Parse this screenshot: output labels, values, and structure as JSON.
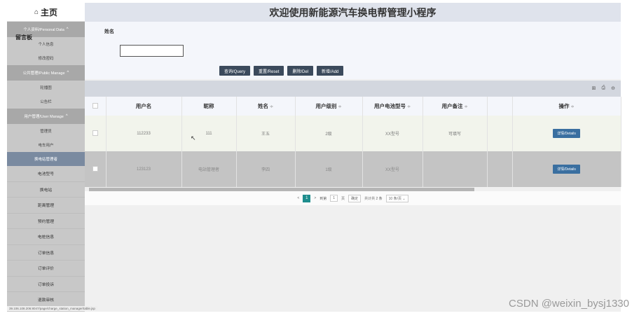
{
  "sidebar": {
    "home_label": "主页",
    "overlay_label": "留言板",
    "groups": [
      {
        "label": "个人资料/Personal Data",
        "items": [
          "个人信息",
          "修改密码"
        ]
      },
      {
        "label": "公共管理/Public Manage",
        "items": [
          "轮播图",
          "公告栏"
        ]
      },
      {
        "label": "用户管理/User Manage",
        "items": [
          "管理员",
          "电车用户",
          "换电站管理者"
        ]
      }
    ],
    "main_items": [
      "电池型号",
      "换电站",
      "距离管理",
      "预约管理",
      "电桩信息",
      "订单信息",
      "订单评价",
      "订单投诉",
      "退款审核"
    ]
  },
  "header": {
    "title": "欢迎使用新能源汽车换电帮管理小程序"
  },
  "search": {
    "name_label": "姓名",
    "name_value": "",
    "buttons": {
      "query": "查询/Query",
      "reset": "重置/Reset",
      "delete": "删除/Del",
      "add": "新增/Add"
    }
  },
  "table": {
    "headers": [
      "用户名",
      "昵称",
      "姓名",
      "用户级别",
      "用户电池型号",
      "用户备注",
      "",
      "操作"
    ],
    "sort_glyph": "≑",
    "rows": [
      {
        "username": "112233",
        "nickname": "111",
        "name": "王五",
        "level": "2级",
        "battery": "XX型号",
        "remark": "可填写",
        "extra": "",
        "action": "详情/Details"
      },
      {
        "username": "123123",
        "nickname": "电站管理者",
        "name": "李四",
        "level": "1级",
        "battery": "XX型号",
        "remark": "",
        "extra": "",
        "action": "详情/Details"
      }
    ]
  },
  "pager": {
    "prev": "<",
    "current": "1",
    "next": ">",
    "goto_label": "到第",
    "goto_value": "1",
    "page_unit": "页",
    "confirm": "确定",
    "total": "共计共 2 条",
    "page_size": "10 条/页"
  },
  "status_url": "39.106.108.206:8047/page/charge_station_manager/table.jsp",
  "watermark": "CSDN @weixin_bysj1330",
  "toolbar_icons": [
    "columns-icon",
    "print-icon",
    "export-icon"
  ],
  "colors": {
    "button": "#3b4a5c",
    "pager_active": "#1e8d8d",
    "detail_button": "#3a6fa0"
  }
}
